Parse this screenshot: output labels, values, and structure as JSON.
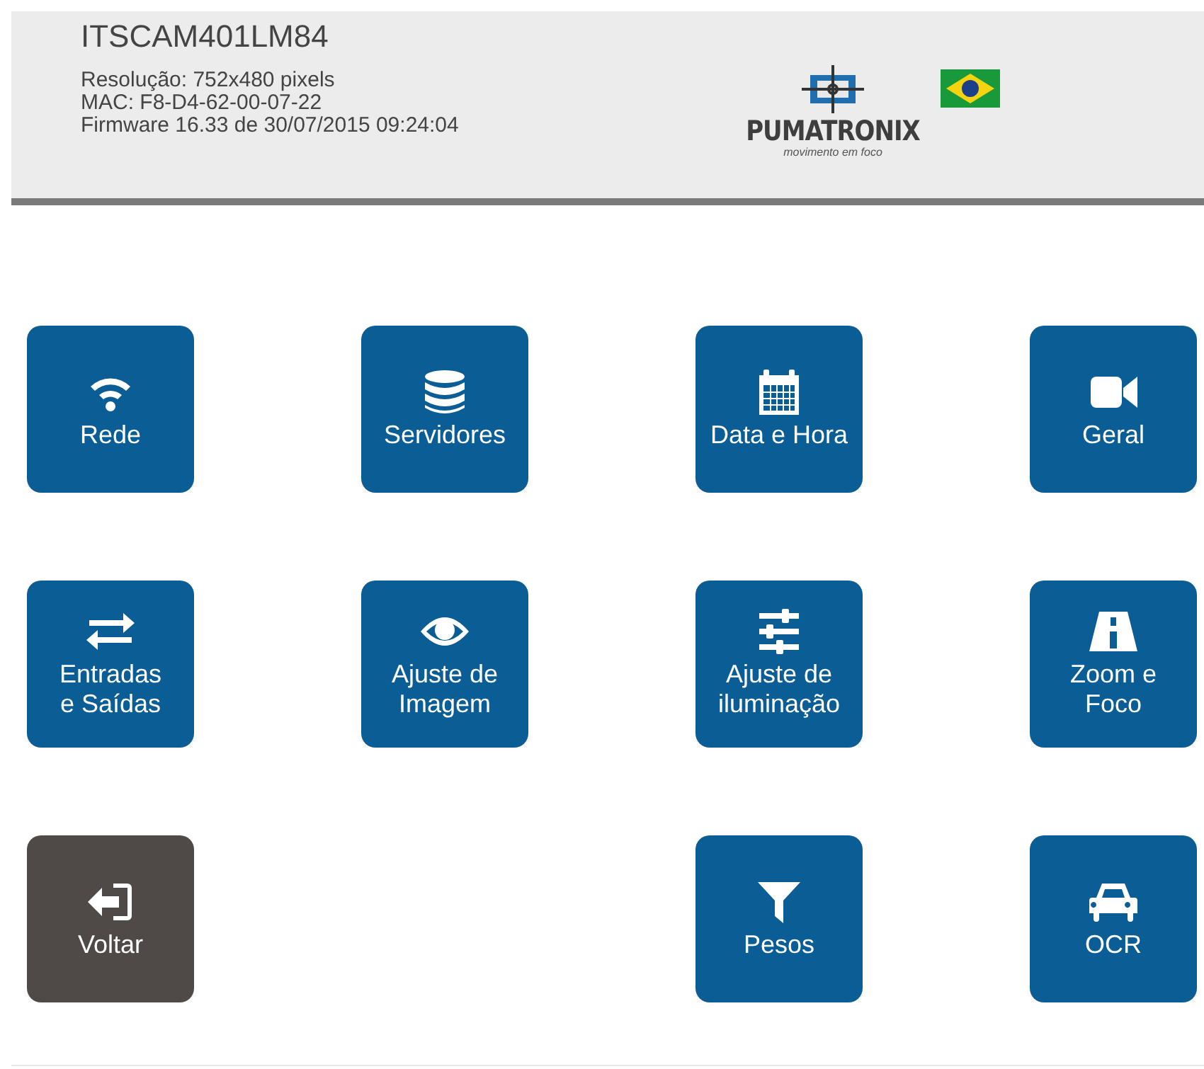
{
  "header": {
    "title": "ITSCAM401LM84",
    "info": [
      "Resolução: 752x480 pixels",
      "MAC: F8-D4-62-00-07-22",
      "Firmware 16.33 de 30/07/2015 09:24:04"
    ],
    "logo": {
      "name": "PUMATRONIX",
      "tagline": "movimento em foco"
    }
  },
  "tiles": [
    {
      "kind": "menu",
      "lines": [
        "Rede"
      ]
    },
    {
      "kind": "menu",
      "lines": [
        "Servidores"
      ]
    },
    {
      "kind": "menu",
      "lines": [
        "Data e Hora"
      ]
    },
    {
      "kind": "menu",
      "lines": [
        "Geral"
      ]
    },
    {
      "kind": "menu",
      "lines": [
        "Entradas",
        "e Saídas"
      ]
    },
    {
      "kind": "menu",
      "lines": [
        "Ajuste de",
        "Imagem"
      ]
    },
    {
      "kind": "menu",
      "lines": [
        "Ajuste de",
        "iluminação"
      ]
    },
    {
      "kind": "menu",
      "lines": [
        "Zoom e",
        "Foco"
      ]
    },
    {
      "kind": "back",
      "lines": [
        "Voltar"
      ]
    },
    {
      "kind": "empty"
    },
    {
      "kind": "menu",
      "lines": [
        "Pesos"
      ]
    },
    {
      "kind": "menu",
      "lines": [
        "OCR"
      ]
    }
  ]
}
